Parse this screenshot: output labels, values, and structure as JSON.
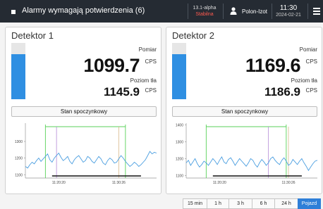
{
  "header": {
    "title": "Alarmy wymagają potwierdzenia (6)",
    "version": "13.1-alpha",
    "stability": "Stabilna",
    "user": "Polon-Izot",
    "time": "11:30",
    "date": "2024-02-21"
  },
  "detectors": [
    {
      "title": "Detektor 1",
      "measurement_label": "Pomiar",
      "measurement": "1099.7",
      "unit": "CPS",
      "background_label": "Poziom tła",
      "background": "1145.9",
      "level_fraction": 0.8,
      "state": "Stan spoczynkowy",
      "chart_data": {
        "type": "line",
        "y_ticks": [
          "1300",
          "1200",
          "1100"
        ],
        "x_ticks": [
          "11:20:20",
          "11:30:26"
        ],
        "ylim": [
          1080,
          1410
        ],
        "x": [
          0,
          1,
          2,
          3,
          4,
          5,
          6,
          7,
          8,
          9,
          10,
          11,
          12,
          13,
          14,
          15,
          16,
          17,
          18,
          19,
          20,
          21,
          22,
          23,
          24,
          25,
          26,
          27,
          28,
          29,
          30,
          31,
          32,
          33,
          34,
          35,
          36,
          37,
          38,
          39,
          40,
          41,
          42,
          43,
          44,
          45,
          46,
          47,
          48,
          49,
          50,
          51,
          52,
          53,
          54,
          55,
          56,
          57,
          58,
          59
        ],
        "y": [
          1150,
          1140,
          1160,
          1175,
          1165,
          1185,
          1200,
          1180,
          1195,
          1210,
          1225,
          1190,
          1175,
          1200,
          1215,
          1230,
          1205,
          1185,
          1195,
          1210,
          1180,
          1165,
          1190,
          1205,
          1215,
          1195,
          1175,
          1185,
          1210,
          1200,
          1180,
          1170,
          1190,
          1210,
          1195,
          1170,
          1160,
          1185,
          1200,
          1190,
          1170,
          1175,
          1195,
          1215,
          1200,
          1180,
          1165,
          1150,
          1160,
          1175,
          1165,
          1150,
          1160,
          1175,
          1190,
          1215,
          1240,
          1225,
          1235,
          1230
        ],
        "markers": {
          "green_start": 9,
          "green_end": 45,
          "purple": 14,
          "tan": 42,
          "black_start": 12,
          "black_end": 52
        }
      }
    },
    {
      "title": "Detektor 2",
      "measurement_label": "Pomiar",
      "measurement": "1169.6",
      "unit": "CPS",
      "background_label": "Poziom tła",
      "background": "1186.9",
      "level_fraction": 0.8,
      "state": "Stan spoczynkowy",
      "chart_data": {
        "type": "line",
        "y_ticks": [
          "1400",
          "1300",
          "1200",
          "1100"
        ],
        "x_ticks": [
          "11:20:20",
          "11:30:26"
        ],
        "ylim": [
          1085,
          1410
        ],
        "x": [
          0,
          1,
          2,
          3,
          4,
          5,
          6,
          7,
          8,
          9,
          10,
          11,
          12,
          13,
          14,
          15,
          16,
          17,
          18,
          19,
          20,
          21,
          22,
          23,
          24,
          25,
          26,
          27,
          28,
          29,
          30,
          31,
          32,
          33,
          34,
          35,
          36,
          37,
          38,
          39,
          40,
          41,
          42,
          43,
          44,
          45,
          46,
          47,
          48,
          49,
          50,
          51,
          52,
          53,
          54,
          55,
          56,
          57,
          58,
          59
        ],
        "y": [
          1175,
          1190,
          1160,
          1180,
          1200,
          1170,
          1150,
          1165,
          1185,
          1175,
          1160,
          1180,
          1200,
          1185,
          1165,
          1190,
          1210,
          1180,
          1170,
          1195,
          1205,
          1185,
          1160,
          1180,
          1200,
          1185,
          1170,
          1155,
          1175,
          1200,
          1190,
          1165,
          1150,
          1175,
          1195,
          1180,
          1160,
          1175,
          1200,
          1210,
          1190,
          1175,
          1165,
          1190,
          1205,
          1185,
          1160,
          1170,
          1195,
          1180,
          1165,
          1185,
          1200,
          1175,
          1155,
          1130,
          1150,
          1170,
          1185,
          1190
        ],
        "markers": {
          "green_start": 9,
          "green_end": 45,
          "purple": 37,
          "tan": 46,
          "black_start": 12,
          "black_end": 52
        }
      }
    }
  ],
  "time_ranges": [
    "15 min",
    "1 h",
    "3 h",
    "6 h",
    "24 h",
    "Pojazd"
  ],
  "active_range": "Pojazd",
  "colors": {
    "header_bg": "#252b33",
    "accent": "#2f8fe2",
    "alert": "#ff5a4f",
    "series": "#4a9ee0",
    "marker_green": "#59d259",
    "marker_purple": "#b48ad6",
    "marker_tan": "#d9b88c"
  }
}
